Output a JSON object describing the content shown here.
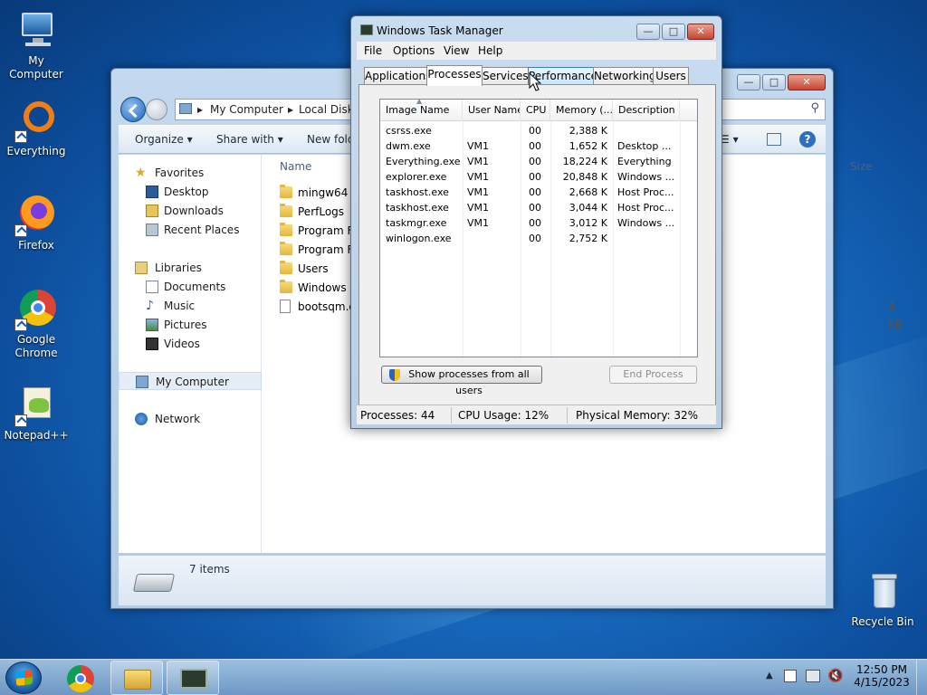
{
  "desktop": {
    "icons": [
      {
        "label": "My Computer"
      },
      {
        "label": "Everything"
      },
      {
        "label": "Firefox"
      },
      {
        "label": "Google Chrome"
      },
      {
        "label": "Notepad++"
      },
      {
        "label": "Recycle Bin"
      }
    ]
  },
  "explorer": {
    "breadcrumb": [
      "My Computer",
      "Local Disk"
    ],
    "toolbar": {
      "organize": "Organize",
      "share_with": "Share with",
      "new_folder": "New fold"
    },
    "nav": {
      "favorites": "Favorites",
      "desktop": "Desktop",
      "downloads": "Downloads",
      "recent_places": "Recent Places",
      "libraries": "Libraries",
      "documents": "Documents",
      "music": "Music",
      "pictures": "Pictures",
      "videos": "Videos",
      "my_computer": "My Computer",
      "network": "Network"
    },
    "columns": {
      "name": "Name",
      "size": "Size"
    },
    "files": [
      {
        "name": "mingw64",
        "type": "folder"
      },
      {
        "name": "PerfLogs",
        "type": "folder"
      },
      {
        "name": "Program Fi",
        "type": "folder"
      },
      {
        "name": "Program Fi",
        "type": "folder"
      },
      {
        "name": "Users",
        "type": "folder"
      },
      {
        "name": "Windows",
        "type": "folder"
      },
      {
        "name": "bootsqm.d",
        "type": "file",
        "size": "4 KB"
      }
    ],
    "status": "7 items"
  },
  "taskmgr": {
    "title": "Windows Task Manager",
    "menu": [
      "File",
      "Options",
      "View",
      "Help"
    ],
    "tabs": [
      "Applications",
      "Processes",
      "Services",
      "Performance",
      "Networking",
      "Users"
    ],
    "active_tab": "Processes",
    "hovered_tab": "Performance",
    "columns": [
      "Image Name",
      "User Name",
      "CPU",
      "Memory (...",
      "Description"
    ],
    "processes": [
      {
        "image": "csrss.exe",
        "user": "",
        "cpu": "00",
        "memory": "2,388 K",
        "desc": ""
      },
      {
        "image": "dwm.exe",
        "user": "VM1",
        "cpu": "00",
        "memory": "1,652 K",
        "desc": "Desktop ..."
      },
      {
        "image": "Everything.exe",
        "user": "VM1",
        "cpu": "00",
        "memory": "18,224 K",
        "desc": "Everything"
      },
      {
        "image": "explorer.exe",
        "user": "VM1",
        "cpu": "00",
        "memory": "20,848 K",
        "desc": "Windows ..."
      },
      {
        "image": "taskhost.exe",
        "user": "VM1",
        "cpu": "00",
        "memory": "2,668 K",
        "desc": "Host Proc..."
      },
      {
        "image": "taskhost.exe",
        "user": "VM1",
        "cpu": "00",
        "memory": "3,044 K",
        "desc": "Host Proc..."
      },
      {
        "image": "taskmgr.exe",
        "user": "VM1",
        "cpu": "00",
        "memory": "3,012 K",
        "desc": "Windows ..."
      },
      {
        "image": "winlogon.exe",
        "user": "",
        "cpu": "00",
        "memory": "2,752 K",
        "desc": ""
      }
    ],
    "show_all_button": "Show processes from all users",
    "end_process_button": "End Process",
    "status": {
      "processes": "Processes: 44",
      "cpu": "CPU Usage: 12%",
      "memory": "Physical Memory: 32%"
    }
  },
  "taskbar": {
    "time": "12:50 PM",
    "date": "4/15/2023"
  }
}
